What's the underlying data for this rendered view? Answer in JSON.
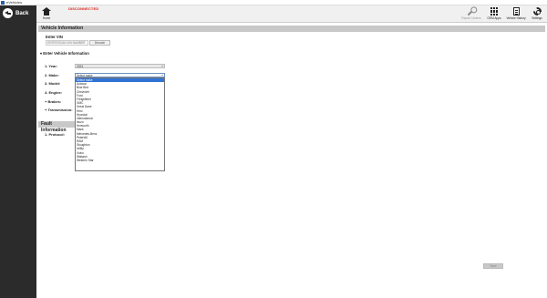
{
  "window": {
    "title": "eVehicles"
  },
  "sidebar": {
    "back_label": "Back"
  },
  "toolbar": {
    "home_label": "Home",
    "status": "DISCONNECTED",
    "status_color": "#d9261c",
    "tools": [
      {
        "label": "Repair Centers",
        "icon": "wrench-icon"
      },
      {
        "label": "OEM Apps",
        "icon": "apps-grid-icon"
      },
      {
        "label": "Vehicle History",
        "icon": "document-icon"
      },
      {
        "label": "Settings",
        "icon": "gear-icon"
      }
    ]
  },
  "vehicle_info": {
    "section_title": "Vehicle Information",
    "enter_vin_label": "Enter VIN",
    "vin_placeholder": "ENTER/SCAN VIN NUMBER",
    "decode_label": "Decode",
    "enter_info_label": "Enter Vehicle Information",
    "fields": [
      {
        "label": "1. Year:",
        "value": "2024"
      },
      {
        "label": "2. Make:",
        "value": "Select make"
      },
      {
        "label": "3. Model:"
      },
      {
        "label": "4. Engine:"
      },
      {
        "label": "Brakes:"
      },
      {
        "label": "Transmission:"
      }
    ],
    "make_options": [
      "Select make",
      "Autocar",
      "Blue Bird",
      "Chevrolet",
      "Ford",
      "Freightliner",
      "GMC",
      "Great Dane",
      "Hino",
      "Hyundai",
      "International",
      "Isuzu",
      "Kenworth",
      "Mack",
      "Mercedes-Benz",
      "Peterbilt",
      "RAM",
      "Stoughton",
      "Utility",
      "Volvo",
      "Wabash",
      "Western Star"
    ]
  },
  "fault_info": {
    "section_title": "Fault Information",
    "protocol_label": "1. Protocol:"
  },
  "footer": {
    "save_label": "Save"
  }
}
